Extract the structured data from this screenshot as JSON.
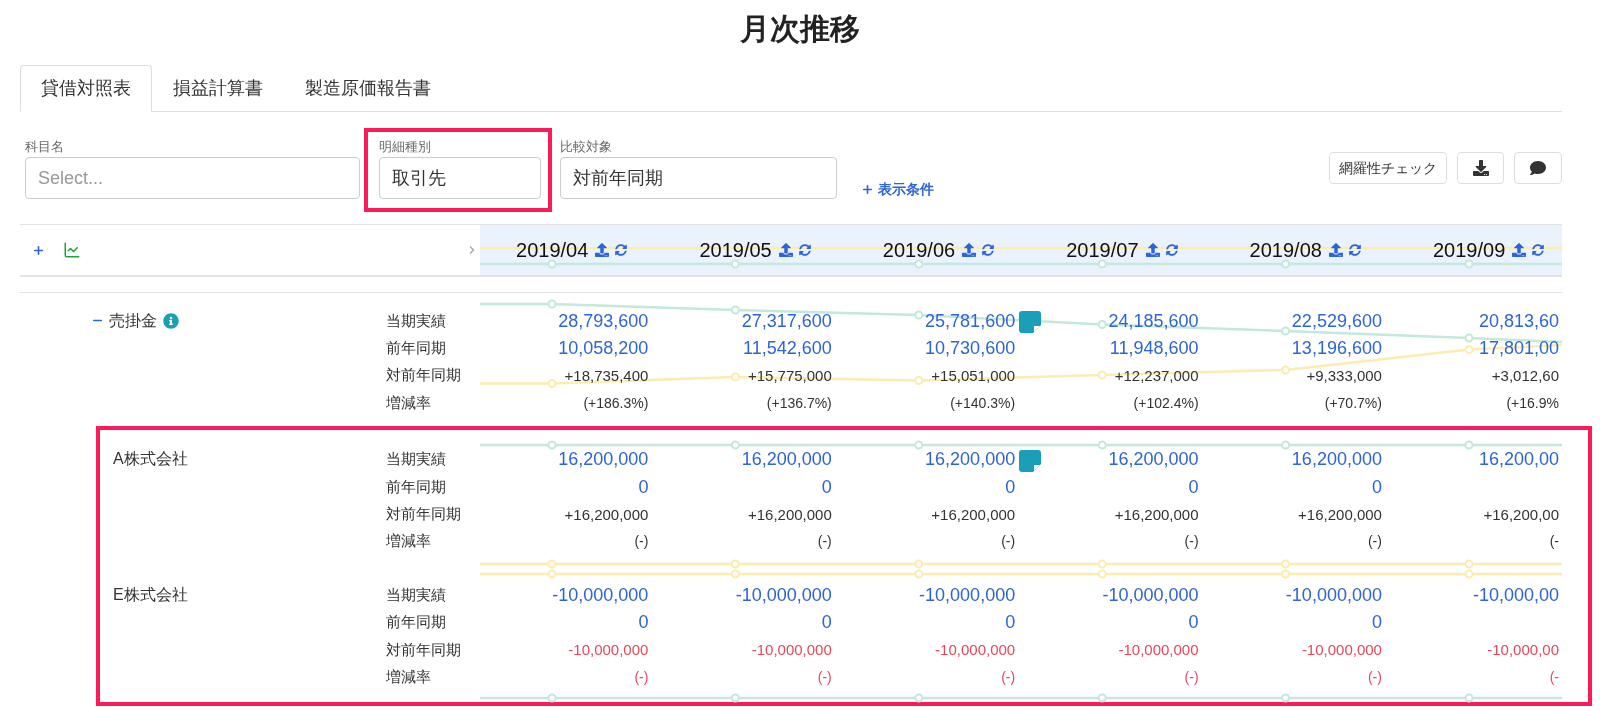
{
  "title": "月次推移",
  "tabs": [
    {
      "label": "貸借対照表",
      "selected": true
    },
    {
      "label": "損益計算書",
      "selected": false
    },
    {
      "label": "製造原価報告書",
      "selected": false
    }
  ],
  "filters": [
    {
      "label": "科目名",
      "placeholder": "Select...",
      "highlighted": false
    },
    {
      "label": "明細種別",
      "value": "取引先",
      "highlighted": true
    },
    {
      "label": "比較対象",
      "value": "対前年同期",
      "highlighted": false
    }
  ],
  "conditions_link": "表示条件",
  "toolbar_buttons": [
    {
      "kind": "text",
      "label": "網羅性チェック"
    },
    {
      "kind": "download"
    },
    {
      "kind": "comment"
    }
  ],
  "months": [
    "2019/04",
    "2019/05",
    "2019/06",
    "2019/07",
    "2019/08",
    "2019/09"
  ],
  "account": {
    "name": "売掛金",
    "expanded": true,
    "rows": [
      {
        "kind": "actual",
        "label": "当期実績",
        "values": [
          "28,793,600",
          "27,317,600",
          "25,781,600",
          "24,185,600",
          "22,529,600",
          "20,813,60"
        ],
        "notes": [
          false,
          false,
          true,
          false,
          false,
          false
        ]
      },
      {
        "kind": "prior",
        "label": "前年同期",
        "values": [
          "10,058,200",
          "11,542,600",
          "10,730,600",
          "11,948,600",
          "13,196,600",
          "17,801,00"
        ],
        "notes": [
          false,
          false,
          false,
          false,
          false,
          false
        ]
      },
      {
        "kind": "diff",
        "label": "対前年同期",
        "negative": false,
        "values": [
          "+18,735,400",
          "+15,775,000",
          "+15,051,000",
          "+12,237,000",
          "+9,333,000",
          "+3,012,60"
        ],
        "notes": [
          false,
          false,
          false,
          false,
          false,
          false
        ]
      },
      {
        "kind": "rate",
        "label": "増減率",
        "negative": false,
        "values": [
          "(+186.3%)",
          "(+136.7%)",
          "(+140.3%)",
          "(+102.4%)",
          "(+70.7%)",
          "(+16.9%"
        ],
        "notes": [
          false,
          false,
          false,
          false,
          false,
          false
        ]
      }
    ]
  },
  "breakdown": {
    "highlighted": true,
    "groups": [
      {
        "name": "A株式会社",
        "rows": [
          {
            "kind": "actual",
            "label": "当期実績",
            "values": [
              "16,200,000",
              "16,200,000",
              "16,200,000",
              "16,200,000",
              "16,200,000",
              "16,200,00"
            ],
            "notes": [
              false,
              false,
              true,
              false,
              false,
              false
            ]
          },
          {
            "kind": "prior",
            "label": "前年同期",
            "values": [
              "0",
              "0",
              "0",
              "0",
              "0"
            ],
            "notes": [
              false,
              false,
              false,
              false,
              false,
              false
            ]
          },
          {
            "kind": "diff",
            "label": "対前年同期",
            "negative": false,
            "values": [
              "+16,200,000",
              "+16,200,000",
              "+16,200,000",
              "+16,200,000",
              "+16,200,000",
              "+16,200,00"
            ],
            "notes": [
              false,
              false,
              false,
              false,
              false,
              false
            ]
          },
          {
            "kind": "rate",
            "label": "増減率",
            "negative": false,
            "values": [
              "(-)",
              "(-)",
              "(-)",
              "(-)",
              "(-)",
              "(-"
            ],
            "notes": [
              false,
              false,
              false,
              false,
              false,
              false
            ]
          }
        ]
      },
      {
        "name": "E株式会社",
        "rows": [
          {
            "kind": "actual",
            "label": "当期実績",
            "values": [
              "-10,000,000",
              "-10,000,000",
              "-10,000,000",
              "-10,000,000",
              "-10,000,000",
              "-10,000,00"
            ],
            "notes": [
              false,
              false,
              false,
              false,
              false,
              false
            ]
          },
          {
            "kind": "prior",
            "label": "前年同期",
            "values": [
              "0",
              "0",
              "0",
              "0",
              "0"
            ],
            "notes": [
              false,
              false,
              false,
              false,
              false,
              false
            ]
          },
          {
            "kind": "diff",
            "label": "対前年同期",
            "negative": true,
            "values": [
              "-10,000,000",
              "-10,000,000",
              "-10,000,000",
              "-10,000,000",
              "-10,000,000",
              "-10,000,00"
            ],
            "notes": [
              false,
              false,
              false,
              false,
              false,
              false
            ]
          },
          {
            "kind": "rate",
            "label": "増減率",
            "negative": true,
            "values": [
              "(-)",
              "(-)",
              "(-)",
              "(-)",
              "(-)",
              "(-"
            ],
            "notes": [
              false,
              false,
              false,
              false,
              false,
              false
            ]
          }
        ]
      }
    ]
  }
}
